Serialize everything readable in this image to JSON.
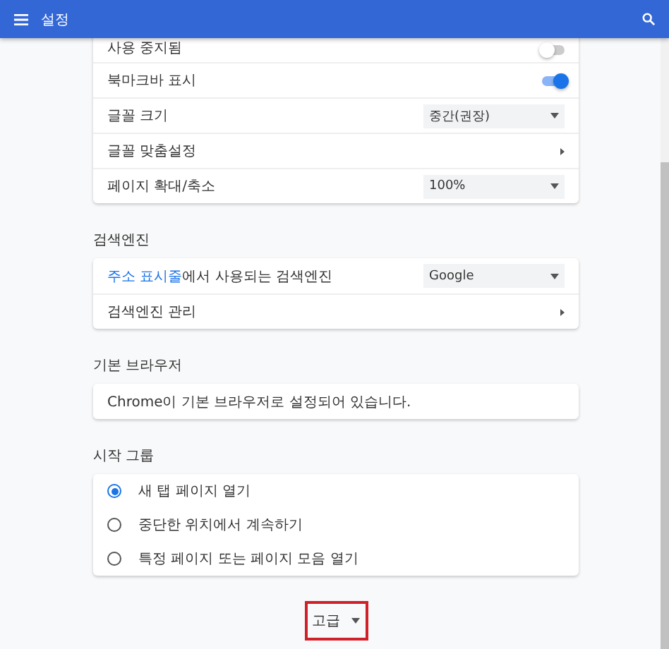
{
  "header": {
    "title": "설정"
  },
  "appearance": {
    "rows": [
      {
        "kind": "toggle",
        "label": "사용 중지됨",
        "on": false
      },
      {
        "kind": "toggle",
        "label": "북마크바 표시",
        "on": true
      },
      {
        "kind": "select",
        "label": "글꼴 크기",
        "value": "중간(권장)"
      },
      {
        "kind": "link",
        "label": "글꼴 맞춤설정"
      },
      {
        "kind": "select",
        "label": "페이지 확대/축소",
        "value": "100%"
      }
    ]
  },
  "search_engine": {
    "title": "검색엔진",
    "rows": [
      {
        "kind": "select",
        "link": "주소 표시줄",
        "rest": "에서 사용되는 검색엔진",
        "value": "Google"
      },
      {
        "kind": "link",
        "label": "검색엔진 관리"
      }
    ]
  },
  "default_browser": {
    "title": "기본 브라우저",
    "text": "Chrome이 기본 브라우저로 설정되어 있습니다."
  },
  "startup": {
    "title": "시작 그룹",
    "options": [
      {
        "label": "새 탭 페이지 열기",
        "selected": true
      },
      {
        "label": "중단한 위치에서 계속하기",
        "selected": false
      },
      {
        "label": "특정 페이지 또는 페이지 모음 열기",
        "selected": false
      }
    ]
  },
  "advanced": {
    "label": "고급"
  }
}
